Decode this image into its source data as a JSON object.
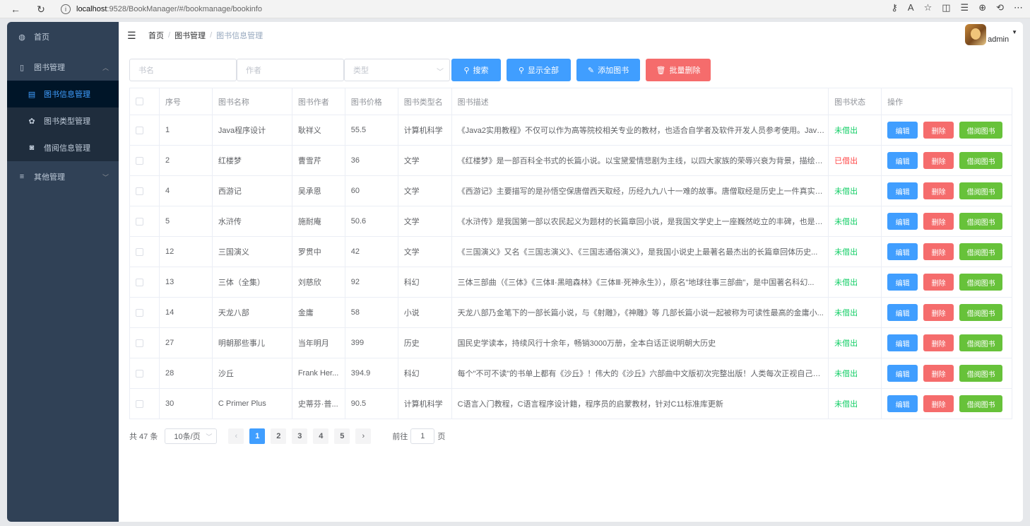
{
  "browser": {
    "back_icon": "←",
    "refresh_icon": "↻",
    "url_host": "localhost",
    "url_path": ":9528/BookManager/#/bookmanage/bookinfo"
  },
  "sidebar": {
    "items": [
      {
        "icon": "dashboard-icon",
        "label": "首页"
      },
      {
        "icon": "book-icon",
        "label": "图书管理"
      },
      {
        "icon": "list-icon",
        "label": "其他管理"
      }
    ],
    "sub_items": [
      {
        "icon": "document-icon",
        "label": "图书信息管理"
      },
      {
        "icon": "gear-icon",
        "label": "图书类型管理"
      },
      {
        "icon": "camera-icon",
        "label": "借阅信息管理"
      }
    ]
  },
  "breadcrumb": {
    "home": "首页",
    "section": "图书管理",
    "current": "图书信息管理"
  },
  "user": {
    "name": "admin"
  },
  "search": {
    "name_placeholder": "书名",
    "author_placeholder": "作者",
    "type_placeholder": "类型",
    "search_label": "搜索",
    "show_all_label": "显示全部",
    "add_label": "添加图书",
    "batch_delete_label": "批量删除"
  },
  "table": {
    "headers": [
      "序号",
      "图书名称",
      "图书作者",
      "图书价格",
      "图书类型名",
      "图书描述",
      "图书状态",
      "操作"
    ],
    "edit_label": "编辑",
    "delete_label": "删除",
    "borrow_label": "借阅图书",
    "rows": [
      {
        "id": "1",
        "name": "Java程序设计",
        "author": "耿祥义",
        "price": "55.5",
        "type": "计算机科学",
        "desc": "《Java2实用教程》不仅可以作为高等院校相关专业的教材，也适合自学者及软件开发人员参考使用。Java是...",
        "status": "未借出",
        "out": false
      },
      {
        "id": "2",
        "name": "红楼梦",
        "author": "曹雪芹",
        "price": "36",
        "type": "文学",
        "desc": "《红楼梦》是一部百科全书式的长篇小说。以宝黛爱情悲剧为主线，以四大家族的荣辱兴衰为背景，描绘出1...",
        "status": "已借出",
        "out": true
      },
      {
        "id": "4",
        "name": "西游记",
        "author": "吴承恩",
        "price": "60",
        "type": "文学",
        "desc": "《西游记》主要描写的是孙悟空保唐僧西天取经，历经九九八十一难的故事。唐僧取经是历史上一件真实的...",
        "status": "未借出",
        "out": false
      },
      {
        "id": "5",
        "name": "水浒传",
        "author": "施耐庵",
        "price": "50.6",
        "type": "文学",
        "desc": "《水浒传》是我国第一部以农民起义为题材的长篇章回小说，是我国文学史上一座巍然屹立的丰碑，也是世...",
        "status": "未借出",
        "out": false
      },
      {
        "id": "12",
        "name": "三国演义",
        "author": "罗贯中",
        "price": "42",
        "type": "文学",
        "desc": "《三国演义》又名《三国志演义》、《三国志通俗演义》，是我国小说史上最著名最杰出的长篇章回体历史...",
        "status": "未借出",
        "out": false
      },
      {
        "id": "13",
        "name": "三体（全集）",
        "author": "刘慈欣",
        "price": "92",
        "type": "科幻",
        "desc": "三体三部曲（《三体》《三体Ⅱ·黑暗森林》《三体Ⅲ·死神永生》），原名\"地球往事三部曲\"，是中国著名科幻...",
        "status": "未借出",
        "out": false
      },
      {
        "id": "14",
        "name": "天龙八部",
        "author": "金庸",
        "price": "58",
        "type": "小说",
        "desc": "天龙八部乃金笔下的一部长篇小说，与《射雕》，《神雕》等 几部长篇小说一起被称为可读性最高的金庸小...",
        "status": "未借出",
        "out": false
      },
      {
        "id": "27",
        "name": "明朝那些事儿",
        "author": "当年明月",
        "price": "399",
        "type": "历史",
        "desc": "国民史学读本，持续风行十余年，畅销3000万册，全本白话正说明朝大历史",
        "status": "未借出",
        "out": false
      },
      {
        "id": "28",
        "name": "沙丘",
        "author": "Frank Her...",
        "price": "394.9",
        "type": "科幻",
        "desc": "每个\"不可不读\"的书单上都有《沙丘》！伟大的《沙丘》六部曲中文版初次完整出版！人类每次正视自己的渺...",
        "status": "未借出",
        "out": false
      },
      {
        "id": "30",
        "name": "C Primer Plus",
        "author": "史蒂芬·普...",
        "price": "90.5",
        "type": "计算机科学",
        "desc": "C语言入门教程，C语言程序设计籍，程序员的启蒙教材，针对C11标准库更新",
        "status": "未借出",
        "out": false
      }
    ]
  },
  "pagination": {
    "total": "共 47 条",
    "page_size": "10条/页",
    "pages": [
      "1",
      "2",
      "3",
      "4",
      "5"
    ],
    "current": "1",
    "goto_prefix": "前往",
    "goto_value": "1",
    "goto_suffix": "页"
  }
}
